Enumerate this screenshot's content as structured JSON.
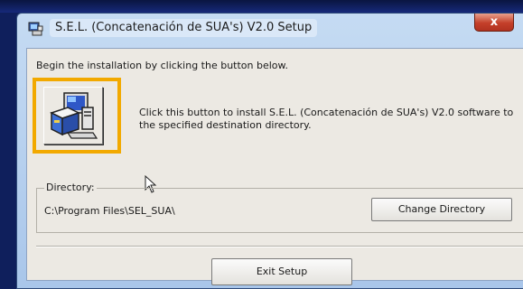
{
  "window": {
    "title": "S.E.L. (Concatenación de SUA's) V2.0 Setup",
    "close_label": "x"
  },
  "setup": {
    "intro": "Begin the installation by clicking the button below.",
    "install_description": "Click this button to install S.E.L. (Concatenación de SUA's) V2.0 software to the specified destination directory.",
    "install_icon": "computer-setup-icon"
  },
  "directory": {
    "label": "Directory:",
    "path": "C:\\Program Files\\SEL_SUA\\",
    "change_label": "Change Directory"
  },
  "footer": {
    "exit_label": "Exit Setup"
  },
  "colors": {
    "highlight": "#f2a900",
    "close": "#c4402a",
    "dialog_bg": "#ece9e3",
    "frame": "#a9c6ea"
  }
}
